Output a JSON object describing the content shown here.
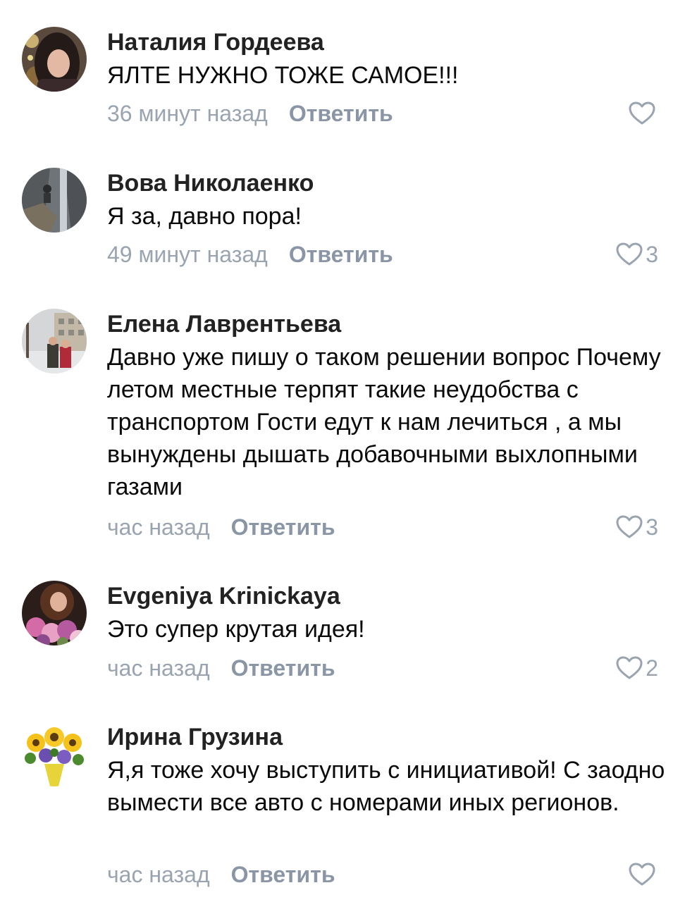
{
  "colors": {
    "author": "#222222",
    "text": "#0a0a0a",
    "meta": "#9aa4b1",
    "reply": "#8a96a6",
    "like_outline": "#9aa4b1"
  },
  "comments": [
    {
      "author": "Наталия Гордеева",
      "text": "ЯЛТЕ НУЖНО ТОЖЕ САМОЕ!!!",
      "time": "36 минут назад",
      "reply": "Ответить",
      "likes": "",
      "like_icon": "heart-outline-icon"
    },
    {
      "author": "Вова Николаенко",
      "text": "Я за, давно пора!",
      "time": "49 минут назад",
      "reply": "Ответить",
      "likes": "3",
      "like_icon": "heart-outline-icon"
    },
    {
      "author": "Елена Лаврентьева",
      "text": "Давно уже пишу о таком решении вопрос Почему летом местные терпят такие неудобства с транспортом Гости едут к нам лечиться , а мы вынуждены дышать добавочными выхлопными газами",
      "time": "час назад",
      "reply": "Ответить",
      "likes": "3",
      "like_icon": "heart-outline-icon"
    },
    {
      "author": "Evgeniya Krinickaya",
      "text": "Это супер крутая идея!",
      "time": "час назад",
      "reply": "Ответить",
      "likes": "2",
      "like_icon": "heart-outline-icon"
    },
    {
      "author": "Ирина Грузина",
      "text": "Я,я тоже хочу выступить с инициативой! С заодно вымести все авто с номерами иных регионов.",
      "time": "час назад",
      "reply": "Ответить",
      "likes": "",
      "like_icon": "heart-outline-icon"
    }
  ]
}
